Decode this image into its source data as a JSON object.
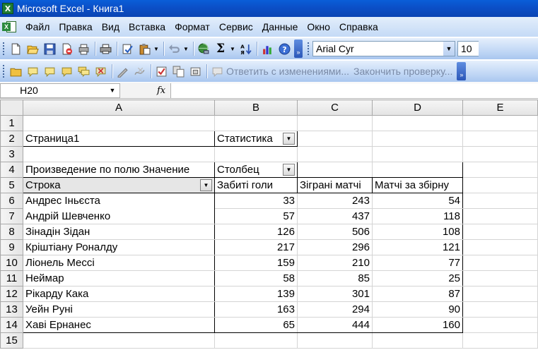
{
  "window": {
    "title": "Microsoft Excel - Книга1"
  },
  "menu": [
    "Файл",
    "Правка",
    "Вид",
    "Вставка",
    "Формат",
    "Сервис",
    "Данные",
    "Окно",
    "Справка"
  ],
  "toolbar": {
    "font_name": "Arial Cyr",
    "font_size": "10"
  },
  "review_toolbar": {
    "reply_label": "Ответить с изменениями...",
    "end_review_label": "Закончить проверку..."
  },
  "formula_bar": {
    "name_box": "H20",
    "fx_label": "fx",
    "formula": ""
  },
  "columns": [
    "A",
    "B",
    "C",
    "D",
    "E"
  ],
  "rows": [
    "1",
    "2",
    "3",
    "4",
    "5",
    "6",
    "7",
    "8",
    "9",
    "10",
    "11",
    "12",
    "13",
    "14",
    "15"
  ],
  "pivot": {
    "page_field_label": "Страница1",
    "page_field_value": "Статистика",
    "data_label": "Произведение по полю Значение",
    "column_field": "Столбец",
    "row_field": "Строка",
    "headers": [
      "Забиті голи",
      "Зіграні матчі",
      "Матчі за збірну"
    ],
    "rows": [
      {
        "name": "Андрес Іньєста",
        "values": [
          "33",
          "243",
          "54"
        ]
      },
      {
        "name": "Андрій Шевченко",
        "values": [
          "57",
          "437",
          "118"
        ]
      },
      {
        "name": "Зінадін Зідан",
        "values": [
          "126",
          "506",
          "108"
        ]
      },
      {
        "name": "Кріштіану Роналду",
        "values": [
          "217",
          "296",
          "121"
        ]
      },
      {
        "name": "Ліонель Мессі",
        "values": [
          "159",
          "210",
          "77"
        ]
      },
      {
        "name": "Неймар",
        "values": [
          "58",
          "85",
          "25"
        ]
      },
      {
        "name": "Рікарду Кака",
        "values": [
          "139",
          "301",
          "87"
        ]
      },
      {
        "name": "Уейн Руні",
        "values": [
          "163",
          "294",
          "90"
        ]
      },
      {
        "name": "Хаві Ернанес",
        "values": [
          "65",
          "444",
          "160"
        ]
      }
    ]
  }
}
